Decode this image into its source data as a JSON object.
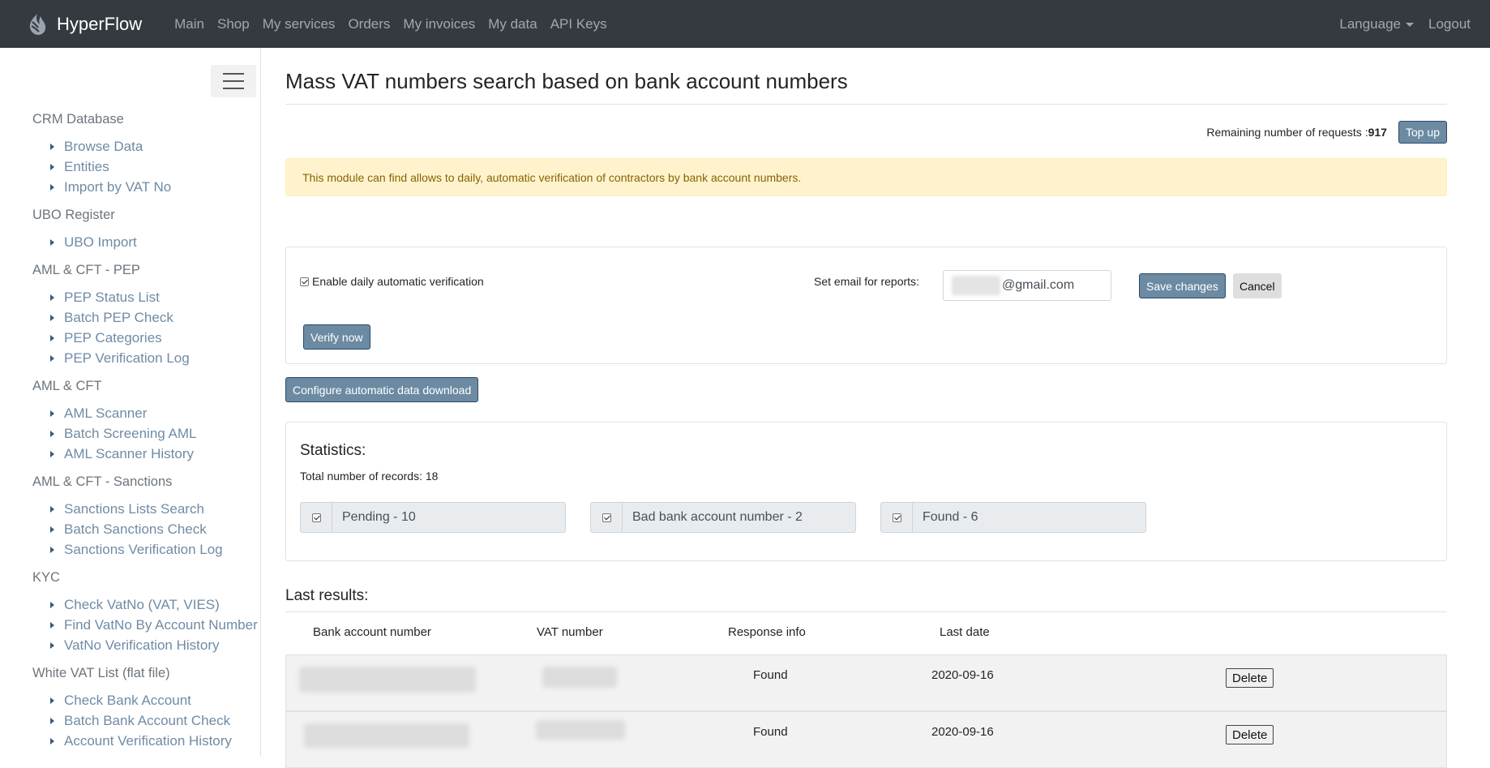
{
  "navbar": {
    "brand": "HyperFlow",
    "links": [
      "Main",
      "Shop",
      "My services",
      "Orders",
      "My invoices",
      "My data",
      "API Keys"
    ],
    "language_label": "Language",
    "logout_label": "Logout"
  },
  "sidebar": {
    "groups": [
      {
        "title": "CRM Database",
        "items": [
          "Browse Data",
          "Entities",
          "Import by VAT No"
        ]
      },
      {
        "title": "UBO Register",
        "items": [
          "UBO Import"
        ]
      },
      {
        "title": "AML & CFT - PEP",
        "items": [
          "PEP Status List",
          "Batch PEP Check",
          "PEP Categories",
          "PEP Verification Log"
        ]
      },
      {
        "title": "AML & CFT",
        "items": [
          "AML Scanner",
          "Batch Screening AML",
          "AML Scanner History"
        ]
      },
      {
        "title": "AML & CFT - Sanctions",
        "items": [
          "Sanctions Lists Search",
          "Batch Sanctions Check",
          "Sanctions Verification Log"
        ]
      },
      {
        "title": "KYC",
        "items": [
          "Check VatNo (VAT, VIES)",
          "Find VatNo By Account Number",
          "VatNo Verification History"
        ]
      },
      {
        "title": "White VAT List (flat file)",
        "items": [
          "Check Bank Account",
          "Batch Bank Account Check",
          "Account Verification History"
        ]
      }
    ]
  },
  "main": {
    "title": "Mass VAT numbers search based on bank account numbers",
    "remaining_label": "Remaining number of requests : ",
    "remaining_value": "917",
    "topup_label": "Top up",
    "alert_text": "This module can find allows to daily, automatic verification of contractors by bank account numbers.",
    "enable_label": "Enable daily automatic verification",
    "email_label": "Set email for reports:",
    "email_value": "@gmail.com",
    "save_label": "Save changes",
    "cancel_label": "Cancel",
    "verify_label": "Verify now",
    "config_label": "Configure automatic data download",
    "stats_title": "Statistics:",
    "stats_total": "Total number of records: 18",
    "stats": [
      "Pending - 10",
      "Bad bank account number - 2",
      "Found - 6"
    ],
    "results_title": "Last results:",
    "columns": [
      "Bank account number",
      "VAT number",
      "Response info",
      "Last date"
    ],
    "rows": [
      {
        "response": "Found",
        "date": "2020-09-16",
        "action": "Delete"
      },
      {
        "response": "Found",
        "date": "2020-09-16",
        "action": "Delete"
      }
    ]
  }
}
